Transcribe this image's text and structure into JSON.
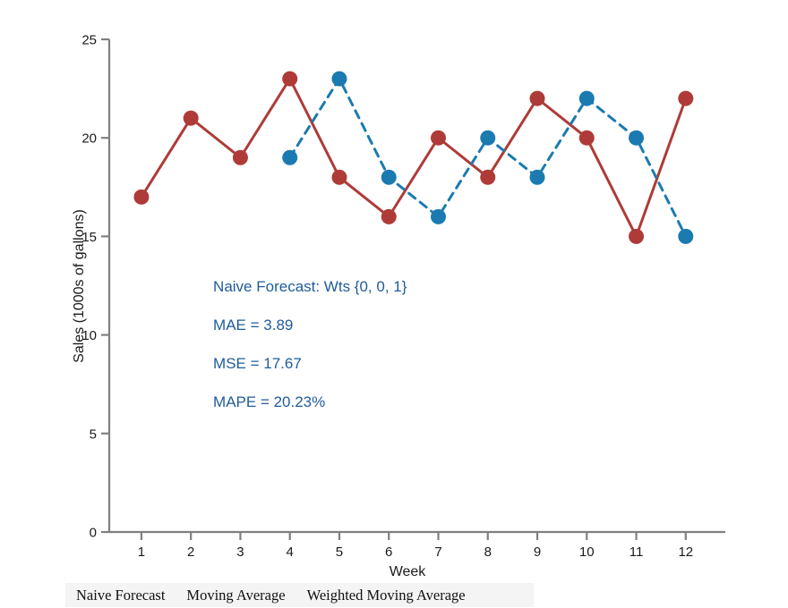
{
  "chart_data": {
    "type": "line",
    "title": "",
    "xlabel": "Week",
    "ylabel": "Sales (1000s of gallons)",
    "x": [
      1,
      2,
      3,
      4,
      5,
      6,
      7,
      8,
      9,
      10,
      11,
      12
    ],
    "xtick_labels": [
      "1",
      "2",
      "3",
      "4",
      "5",
      "6",
      "7",
      "8",
      "9",
      "10",
      "11",
      "12"
    ],
    "ytick_labels": [
      "0",
      "5",
      "10",
      "15",
      "20",
      "25"
    ],
    "yticks": [
      0,
      5,
      10,
      15,
      20,
      25
    ],
    "xlim": [
      0.35,
      12.8
    ],
    "ylim": [
      0,
      25
    ],
    "grid": false,
    "legend_position": "none",
    "series": [
      {
        "name": "Sales",
        "color": "#ae3b37",
        "linestyle": "solid",
        "marker": "circle",
        "x": [
          1,
          2,
          3,
          4,
          5,
          6,
          7,
          8,
          9,
          10,
          11,
          12
        ],
        "values": [
          17,
          21,
          19,
          23,
          18,
          16,
          20,
          18,
          22,
          20,
          15,
          22
        ]
      },
      {
        "name": "Naive Forecast",
        "color": "#1b7ab0",
        "linestyle": "dashed",
        "marker": "circle",
        "x": [
          4,
          5,
          6,
          7,
          8,
          9,
          10,
          11,
          12
        ],
        "values": [
          19,
          23,
          18,
          16,
          20,
          18,
          22,
          20,
          15
        ]
      }
    ],
    "annotations": [
      {
        "text": "Naive Forecast: Wts {0, 0, 1}",
        "x": 2.45,
        "y": 12.2
      },
      {
        "text": "MAE = 3.89",
        "x": 2.45,
        "y": 10.25
      },
      {
        "text": "MSE = 17.67",
        "x": 2.45,
        "y": 8.3
      },
      {
        "text": "MAPE = 20.23%",
        "x": 2.45,
        "y": 6.35
      }
    ]
  },
  "colors": {
    "actual_red": "#ae3b37",
    "forecast_blue": "#1b7ab0",
    "annotation_blue": "#1f5c99",
    "axis_gray": "#808080",
    "tab_bar_background": "#f4f4f4",
    "page_background": "#ffffff"
  },
  "tab_bar": {
    "tabs": [
      {
        "label": "Naive Forecast",
        "selected": true
      },
      {
        "label": "Moving Average",
        "selected": false
      },
      {
        "label": "Weighted Moving Average",
        "selected": false
      }
    ]
  }
}
